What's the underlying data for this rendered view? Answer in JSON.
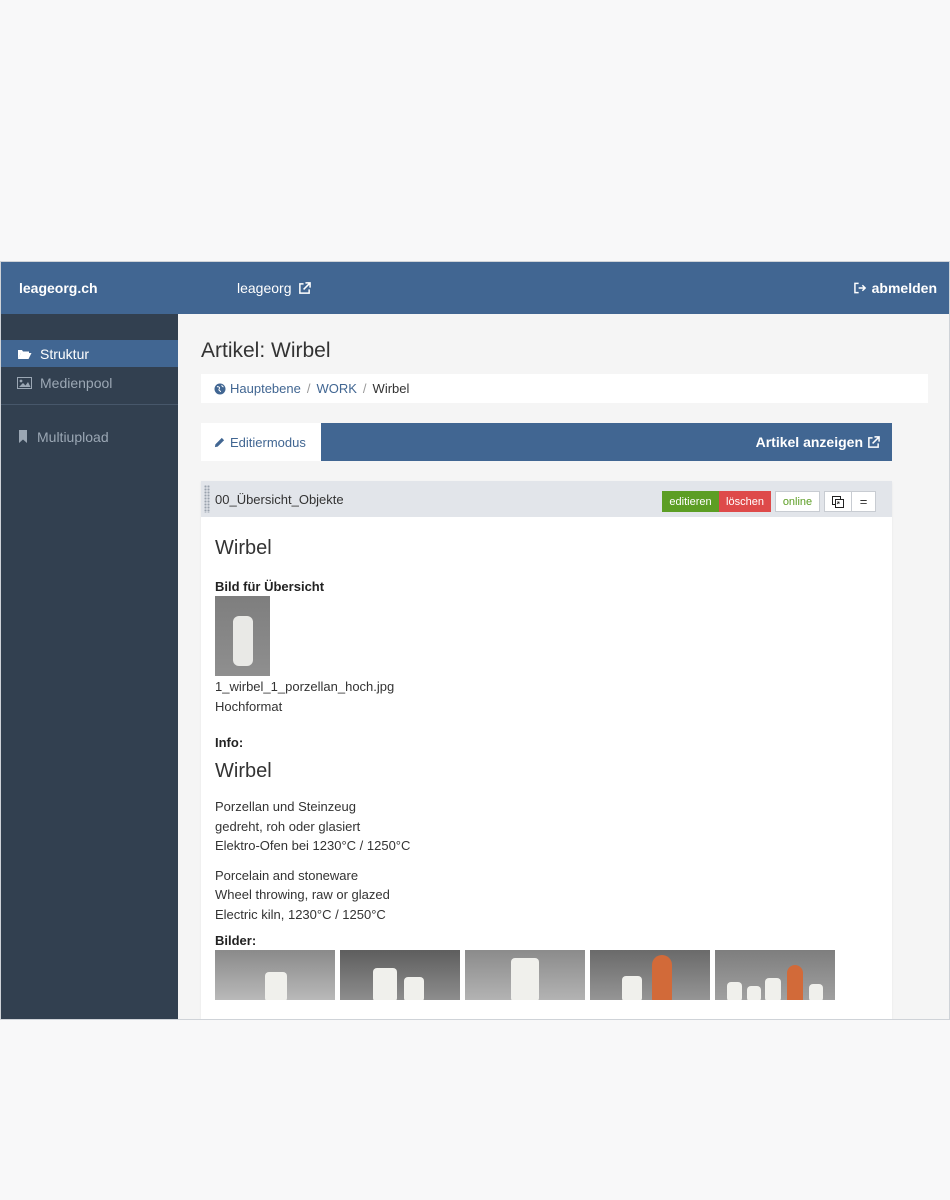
{
  "header": {
    "brand": "leageorg.ch",
    "site_link": "leageorg",
    "logout": "abmelden"
  },
  "sidebar": {
    "items": [
      {
        "label": "Struktur",
        "icon": "folder-open-icon",
        "active": true
      },
      {
        "label": "Medienpool",
        "icon": "image-icon",
        "active": false
      },
      {
        "label": "Multiupload",
        "icon": "bookmark-icon",
        "active": false
      }
    ]
  },
  "page": {
    "title": "Artikel: Wirbel",
    "breadcrumb": [
      "Hauptebene",
      "WORK",
      "Wirbel"
    ]
  },
  "tabs": {
    "active": "Editiermodus",
    "view_article": "Artikel anzeigen"
  },
  "slice": {
    "title": "00_Übersicht_Objekte",
    "buttons": {
      "edit": "editieren",
      "delete": "löschen",
      "status": "online",
      "move": "="
    },
    "content": {
      "heading": "Wirbel",
      "overview_label": "Bild für Übersicht",
      "image_filename": "1_wirbel_1_porzellan_hoch.jpg",
      "image_format": "Hochformat",
      "info_label": "Info:",
      "info_heading": "Wirbel",
      "text_de": [
        "Porzellan und Steinzeug",
        "gedreht, roh oder glasiert",
        "Elektro-Ofen bei 1230°C / 1250°C"
      ],
      "text_en": [
        "Porcelain and stoneware",
        "Wheel throwing, raw or glazed",
        "Electric kiln, 1230°C / 1250°C"
      ],
      "images_label": "Bilder:"
    }
  },
  "colors": {
    "primary": "#416692",
    "sidebar": "#324050",
    "success": "#5c9e24",
    "danger": "#de4a4a"
  }
}
